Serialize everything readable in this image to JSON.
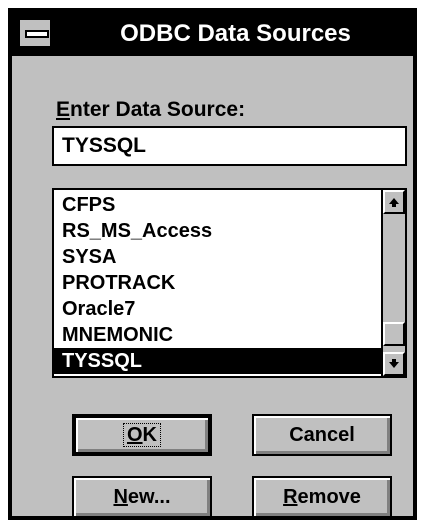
{
  "window": {
    "title": "ODBC Data Sources"
  },
  "data_source": {
    "label_accel": "E",
    "label_rest": "nter Data Source:",
    "value": "TYSSQL"
  },
  "list": {
    "items": [
      "CFPS",
      "RS_MS_Access",
      "SYSA",
      "PROTRACK",
      "Oracle7",
      "MNEMONIC",
      "TYSSQL"
    ],
    "selected_index": 6
  },
  "buttons": {
    "ok_accel": "O",
    "ok_rest": "K",
    "cancel": "Cancel",
    "new_accel": "N",
    "new_rest": "ew...",
    "remove_accel": "R",
    "remove_rest": "emove"
  },
  "icons": {
    "system_menu": "system-menu-icon",
    "scroll_up": "scroll-up-arrow-icon",
    "scroll_down": "scroll-down-arrow-icon"
  },
  "colors": {
    "face": "#c0c0c0",
    "title_bar": "#000000",
    "selection": "#000000"
  }
}
